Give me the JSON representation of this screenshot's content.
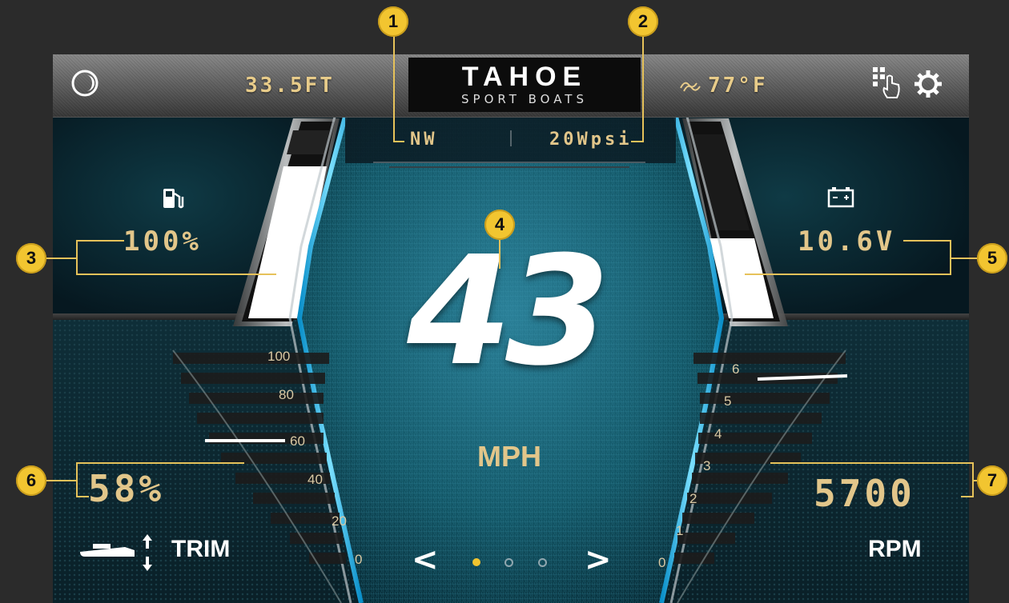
{
  "top_bar": {
    "depth": "33.5FT",
    "brand_name": "TAHOE",
    "brand_sub": "SPORT BOATS",
    "water_temp": "77°F"
  },
  "heading": {
    "direction": "NW",
    "pressure": "20Wpsi"
  },
  "fuel": {
    "value": "100%",
    "level_fraction": 1.0
  },
  "battery": {
    "value": "10.6V"
  },
  "speed": {
    "value": "43",
    "unit": "MPH"
  },
  "trim": {
    "value": "58%",
    "label": "TRIM",
    "scale_ticks": [
      "100",
      "80",
      "60",
      "40",
      "20",
      "0"
    ]
  },
  "rpm": {
    "value": "5700",
    "label": "RPM",
    "scale_ticks": [
      "6",
      "5",
      "4",
      "3",
      "2",
      "1",
      "0"
    ]
  },
  "pager": {
    "prev": "<",
    "next": ">",
    "active_index": 0,
    "count": 3
  },
  "callouts": [
    "1",
    "2",
    "3",
    "4",
    "5",
    "6",
    "7"
  ],
  "colors": {
    "accent_gold": "#e2c68a",
    "callout_yellow": "#f2c530",
    "glow_blue": "#29b6e8"
  }
}
